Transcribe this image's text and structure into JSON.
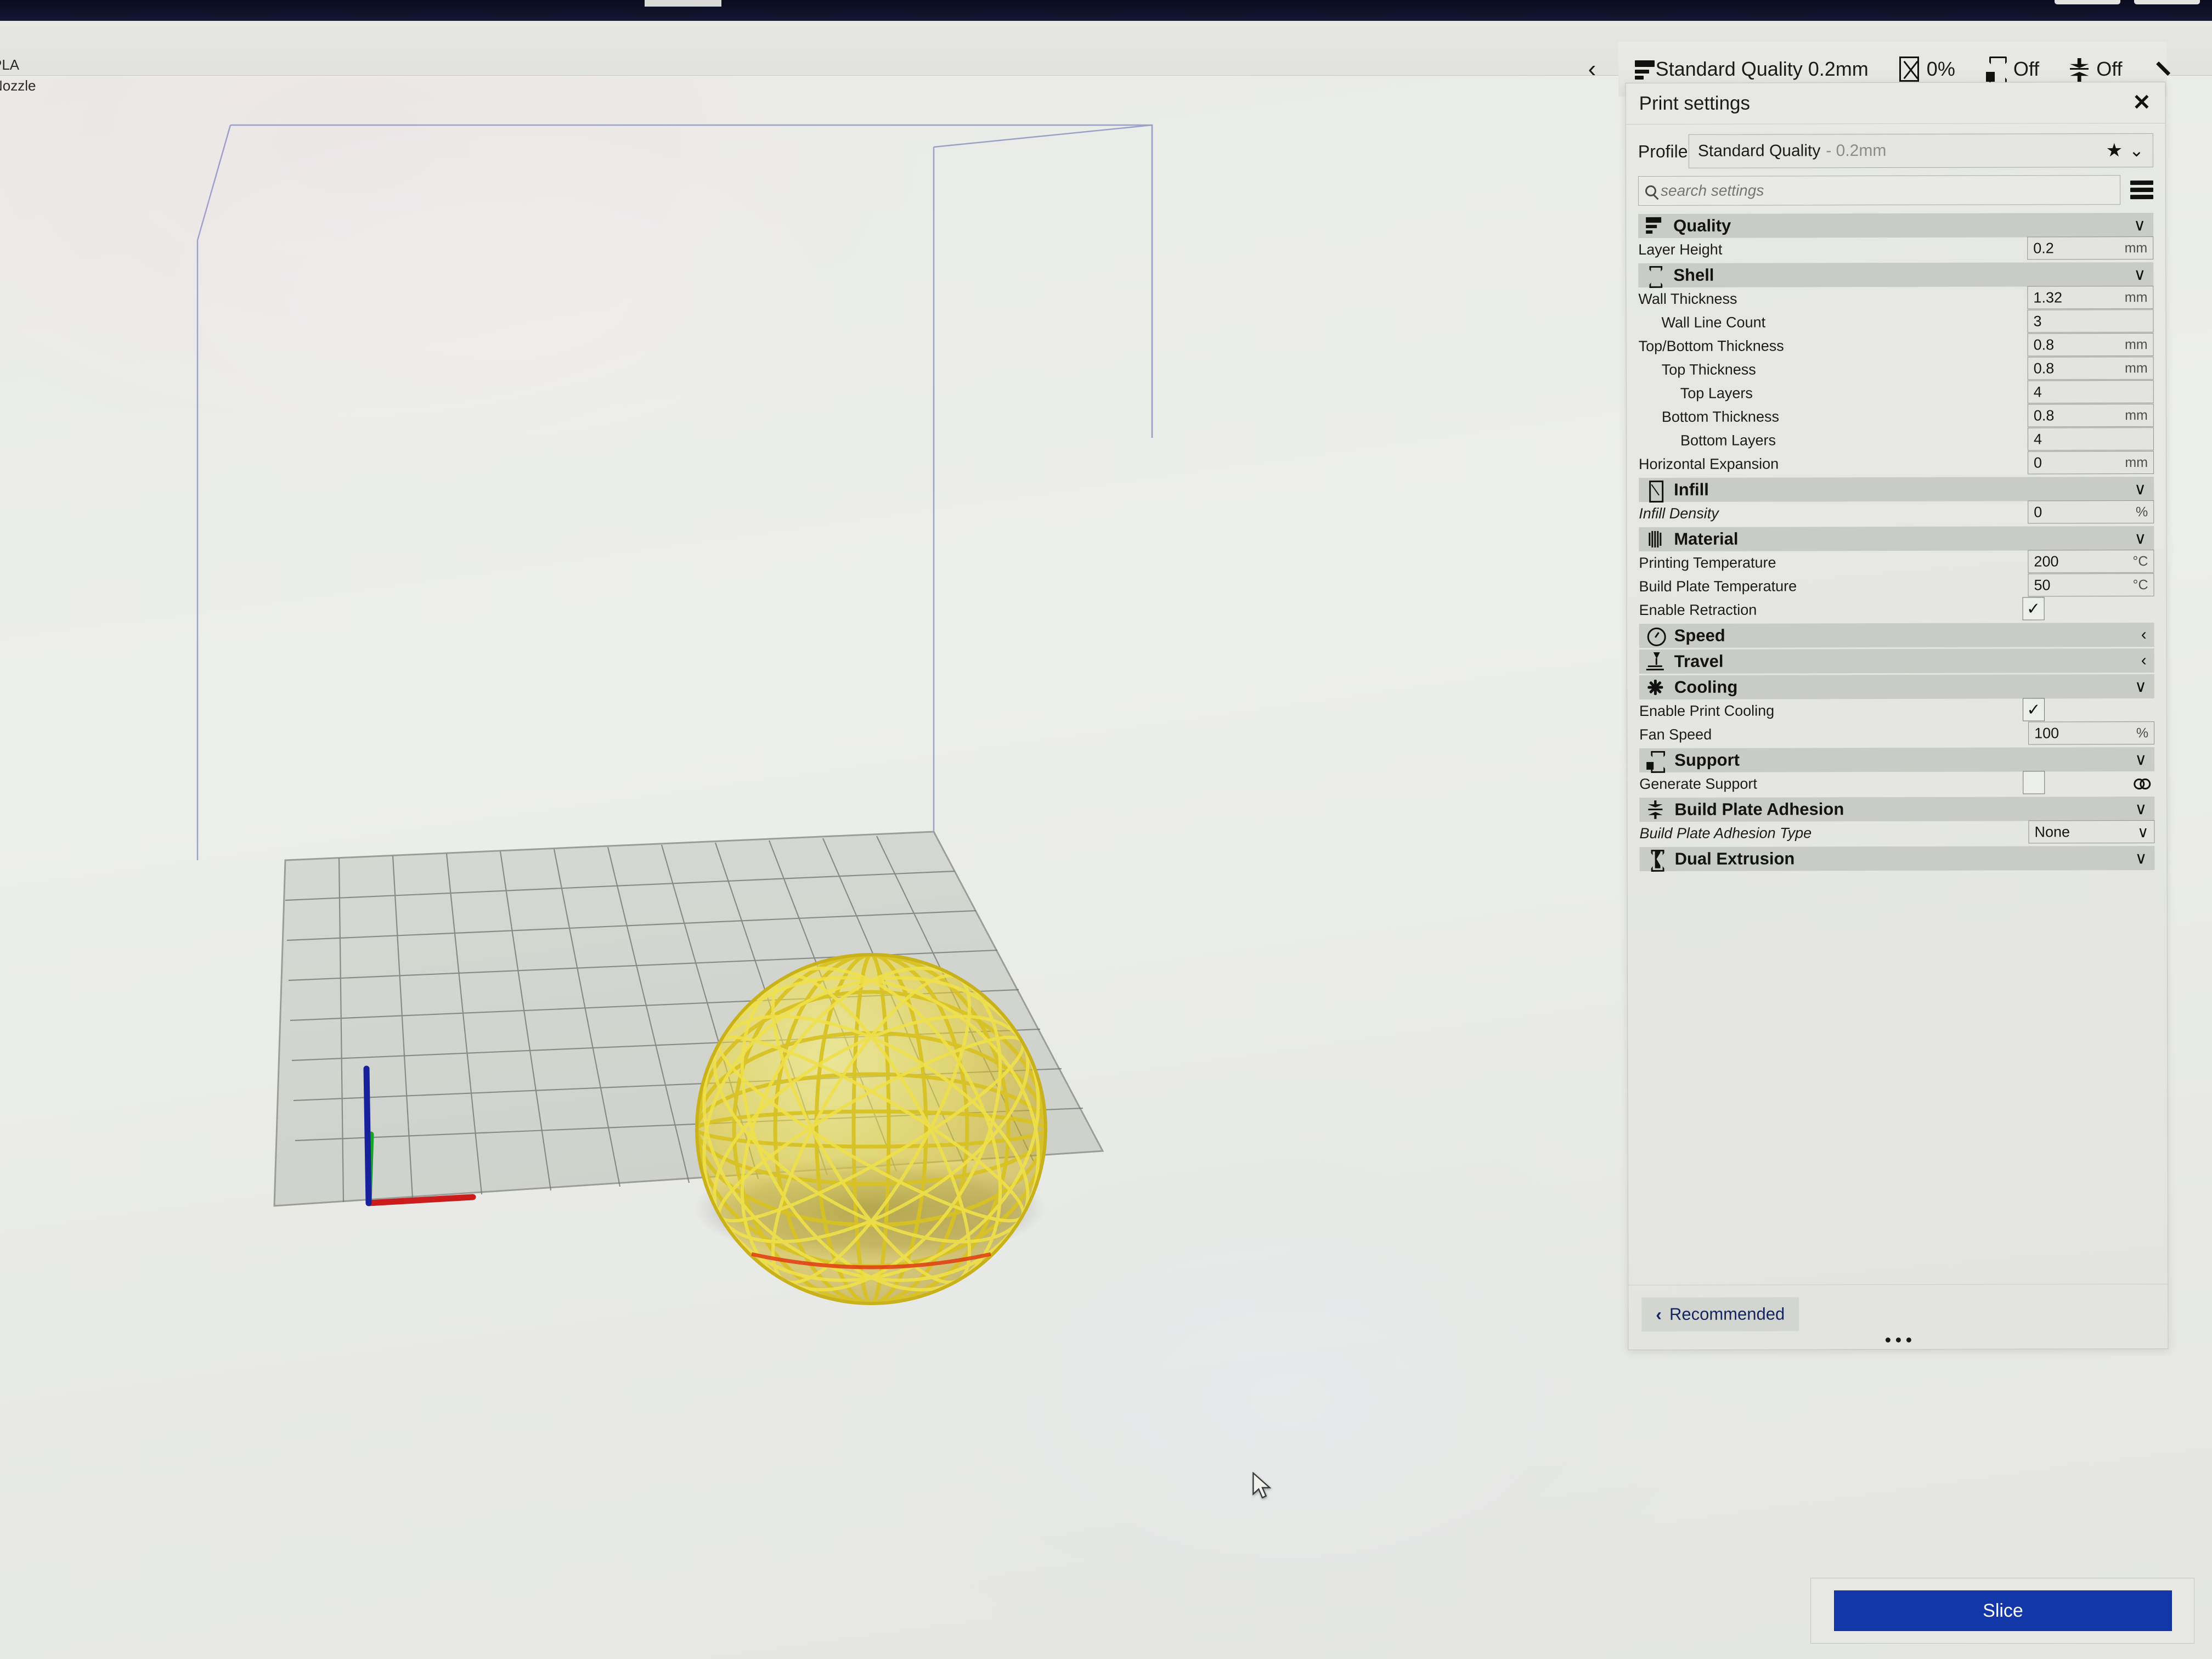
{
  "app": {
    "material_lines": [
      "PLA",
      "Nozzle"
    ],
    "collapse_icon": "chevron-left-icon"
  },
  "topbar": {
    "quality_icon": "quality-layers-icon",
    "profile_label": "Standard Quality 0.2mm",
    "stats": [
      {
        "icon": "infill-icon",
        "value": "0%"
      },
      {
        "icon": "support-icon",
        "value": "Off"
      },
      {
        "icon": "adhesion-icon",
        "value": "Off"
      }
    ],
    "edit_icon": "pencil-icon"
  },
  "panel": {
    "title": "Print settings",
    "close_label": "✕",
    "profile": {
      "label": "Profile",
      "name": "Standard Quality",
      "sub": "- 0.2mm",
      "star_icon": "star-icon",
      "caret_icon": "chevron-down-icon"
    },
    "search": {
      "placeholder": "search settings",
      "icon": "search-icon",
      "menu_icon": "hamburger-menu-icon"
    },
    "sections": [
      {
        "id": "quality",
        "name": "Quality",
        "icon": "quality-icon",
        "chevron": "∨",
        "rows": [
          {
            "label": "Layer Height",
            "indent": 0,
            "italic": false,
            "link": true,
            "revert": false,
            "fx": false,
            "value": "0.2",
            "unit": "mm",
            "control": "field"
          }
        ]
      },
      {
        "id": "shell",
        "name": "Shell",
        "icon": "shell-icon",
        "chevron": "∨",
        "rows": [
          {
            "label": "Wall Thickness",
            "indent": 0,
            "italic": false,
            "link": false,
            "revert": false,
            "fx": false,
            "value": "1.32",
            "unit": "mm",
            "control": "field"
          },
          {
            "label": "Wall Line Count",
            "indent": 1,
            "italic": false,
            "link": false,
            "revert": false,
            "fx": false,
            "value": "3",
            "unit": "",
            "control": "field"
          },
          {
            "label": "Top/Bottom Thickness",
            "indent": 0,
            "italic": false,
            "link": false,
            "revert": false,
            "fx": false,
            "value": "0.8",
            "unit": "mm",
            "control": "field"
          },
          {
            "label": "Top Thickness",
            "indent": 1,
            "italic": false,
            "link": false,
            "revert": false,
            "fx": false,
            "value": "0.8",
            "unit": "mm",
            "control": "field"
          },
          {
            "label": "Top Layers",
            "indent": 2,
            "italic": false,
            "link": false,
            "revert": false,
            "fx": false,
            "value": "4",
            "unit": "",
            "control": "field"
          },
          {
            "label": "Bottom Thickness",
            "indent": 1,
            "italic": false,
            "link": false,
            "revert": false,
            "fx": false,
            "value": "0.8",
            "unit": "mm",
            "control": "field"
          },
          {
            "label": "Bottom Layers",
            "indent": 2,
            "italic": false,
            "link": false,
            "revert": false,
            "fx": false,
            "value": "4",
            "unit": "",
            "control": "field"
          },
          {
            "label": "Horizontal Expansion",
            "indent": 0,
            "italic": false,
            "link": false,
            "revert": false,
            "fx": false,
            "value": "0",
            "unit": "mm",
            "control": "field"
          }
        ]
      },
      {
        "id": "infill",
        "name": "Infill",
        "icon": "infill-icon",
        "chevron": "∨",
        "rows": [
          {
            "label": "Infill Density",
            "indent": 0,
            "italic": true,
            "link": false,
            "revert": true,
            "fx": false,
            "value": "0",
            "unit": "%",
            "control": "field"
          }
        ]
      },
      {
        "id": "material",
        "name": "Material",
        "icon": "material-icon",
        "chevron": "∨",
        "rows": [
          {
            "label": "Printing Temperature",
            "indent": 0,
            "italic": false,
            "link": false,
            "revert": false,
            "fx": false,
            "value": "200",
            "unit": "°C",
            "control": "field"
          },
          {
            "label": "Build Plate Temperature",
            "indent": 0,
            "italic": false,
            "link": true,
            "revert": false,
            "fx": false,
            "value": "50",
            "unit": "°C",
            "control": "field"
          },
          {
            "label": "Enable Retraction",
            "indent": 0,
            "italic": false,
            "link": false,
            "revert": false,
            "fx": false,
            "value": "✓",
            "unit": "",
            "control": "checkbox",
            "checked": true
          }
        ]
      },
      {
        "id": "speed",
        "name": "Speed",
        "icon": "speed-icon",
        "chevron": "‹",
        "rows": []
      },
      {
        "id": "travel",
        "name": "Travel",
        "icon": "travel-icon",
        "chevron": "‹",
        "rows": []
      },
      {
        "id": "cooling",
        "name": "Cooling",
        "icon": "cooling-icon",
        "chevron": "∨",
        "rows": [
          {
            "label": "Enable Print Cooling",
            "indent": 0,
            "italic": false,
            "link": false,
            "revert": false,
            "fx": false,
            "value": "✓",
            "unit": "",
            "control": "checkbox",
            "checked": true
          },
          {
            "label": "Fan Speed",
            "indent": 0,
            "italic": false,
            "link": false,
            "revert": false,
            "fx": true,
            "value": "100",
            "unit": "%",
            "control": "field"
          }
        ]
      },
      {
        "id": "support",
        "name": "Support",
        "icon": "support-icon",
        "chevron": "∨",
        "rows": [
          {
            "label": "Generate Support",
            "indent": 0,
            "italic": false,
            "link": true,
            "revert": false,
            "fx": false,
            "value": "",
            "unit": "",
            "control": "checkbox",
            "checked": false
          }
        ]
      },
      {
        "id": "adhesion",
        "name": "Build Plate Adhesion",
        "icon": "adhesion-icon",
        "chevron": "∨",
        "rows": [
          {
            "label": "Build Plate Adhesion Type",
            "indent": 0,
            "italic": true,
            "link": true,
            "revert": true,
            "fx": false,
            "value": "None",
            "unit": "∨",
            "control": "dropdown"
          }
        ]
      },
      {
        "id": "dual",
        "name": "Dual Extrusion",
        "icon": "dual-extrusion-icon",
        "chevron": "∨",
        "rows": []
      }
    ],
    "footer": {
      "recommended_label": "Recommended",
      "recommended_chevron": "‹",
      "grip_icon": "drag-handle-icon"
    }
  },
  "slice": {
    "label": "Slice",
    "color": "#1336a8"
  },
  "viewport": {
    "model": "geodesic-sphere",
    "model_color": "#e8d32a",
    "build_plate": "grid-platform",
    "axes": {
      "x": "#cc1b1b",
      "y": "#17a22a",
      "z": "#18219c"
    },
    "cursor_icon": "mouse-pointer-icon"
  }
}
